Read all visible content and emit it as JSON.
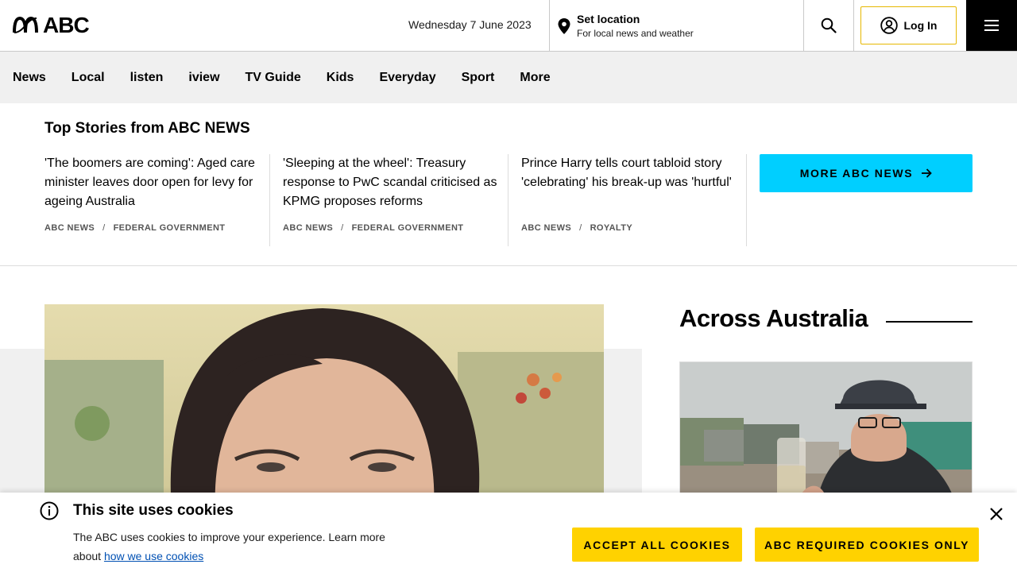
{
  "header": {
    "logo_text": "ABC",
    "date": "Wednesday 7 June 2023",
    "location_title": "Set location",
    "location_subtitle": "For local news and weather",
    "login_label": "Log In"
  },
  "nav": {
    "items": [
      {
        "label": "News"
      },
      {
        "label": "Local"
      },
      {
        "label": "listen"
      },
      {
        "label": "iview"
      },
      {
        "label": "TV Guide"
      },
      {
        "label": "Kids"
      },
      {
        "label": "Everyday"
      },
      {
        "label": "Sport"
      },
      {
        "label": "More"
      }
    ]
  },
  "top_stories": {
    "title": "Top Stories from ABC NEWS",
    "stories": [
      {
        "headline": "'The boomers are coming': Aged care minister leaves door open for levy for ageing Australia",
        "source": "ABC NEWS",
        "topic": "FEDERAL GOVERNMENT"
      },
      {
        "headline": "'Sleeping at the wheel': Treasury response to PwC scandal criticised as KPMG proposes reforms",
        "source": "ABC NEWS",
        "topic": "FEDERAL GOVERNMENT"
      },
      {
        "headline": "Prince Harry tells court tabloid story 'celebrating' his break-up was 'hurtful'",
        "source": "ABC NEWS",
        "topic": "ROYALTY"
      }
    ],
    "separator": "/",
    "more_button": "MORE ABC NEWS"
  },
  "across_australia": {
    "title": "Across Australia"
  },
  "cookie_banner": {
    "title": "This site uses cookies",
    "text": "The ABC uses cookies to improve your experience. Learn more about",
    "link": "how we use cookies",
    "accept_all": "ACCEPT ALL COOKIES",
    "required_only": "ABC REQUIRED COOKIES ONLY"
  },
  "colors": {
    "brand_yellow": "#ffd200",
    "news_cyan": "#00cfff",
    "nav_background": "#f0f0f0"
  }
}
